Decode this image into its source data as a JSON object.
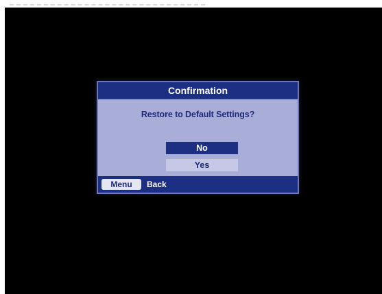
{
  "dialog": {
    "title": "Confirmation",
    "message": "Restore to Default Settings?",
    "options": [
      {
        "label": "No",
        "selected": true
      },
      {
        "label": "Yes",
        "selected": false
      }
    ],
    "footer": {
      "key_label": "Menu",
      "action_label": "Back"
    }
  },
  "colors": {
    "background": "#000000",
    "dialog_body": "#a9aed8",
    "header_footer": "#1c2f82",
    "selected_option": "#1c2f82",
    "unselected_option": "#c6c9e6",
    "text_dark": "#1e2a78",
    "text_light": "#ffffff"
  }
}
